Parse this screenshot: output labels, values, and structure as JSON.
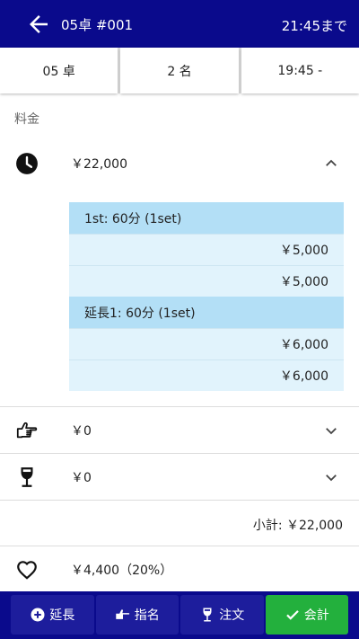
{
  "header": {
    "title": "05卓 #001",
    "until": "21:45まで"
  },
  "info": {
    "table": "05 卓",
    "guests": "2 名",
    "start": "19:45 -"
  },
  "section_label": "料金",
  "charge": {
    "amount": "￥22,000",
    "rows": [
      {
        "type": "head",
        "text": "1st: 60分 (1set)"
      },
      {
        "type": "value",
        "text": "￥5,000"
      },
      {
        "type": "value",
        "text": "￥5,000"
      },
      {
        "type": "head",
        "text": "延長1: 60分 (1set)"
      },
      {
        "type": "value",
        "text": "￥6,000"
      },
      {
        "type": "value",
        "text": "￥6,000"
      }
    ]
  },
  "nomination": {
    "amount": "￥0"
  },
  "drinks": {
    "amount": "￥0"
  },
  "subtotal": "小計: ￥22,000",
  "tax": {
    "amount": "￥4,400（20%）"
  },
  "footer": {
    "extend": "延長",
    "nominate": "指名",
    "order": "注文",
    "checkout": "会計"
  },
  "colors": {
    "header_bg": "#0a0a8c",
    "button_bg": "#1d1d9c",
    "checkout_bg": "#23b03d",
    "table_head": "#b3dff6",
    "table_row": "#e1f3fc"
  }
}
